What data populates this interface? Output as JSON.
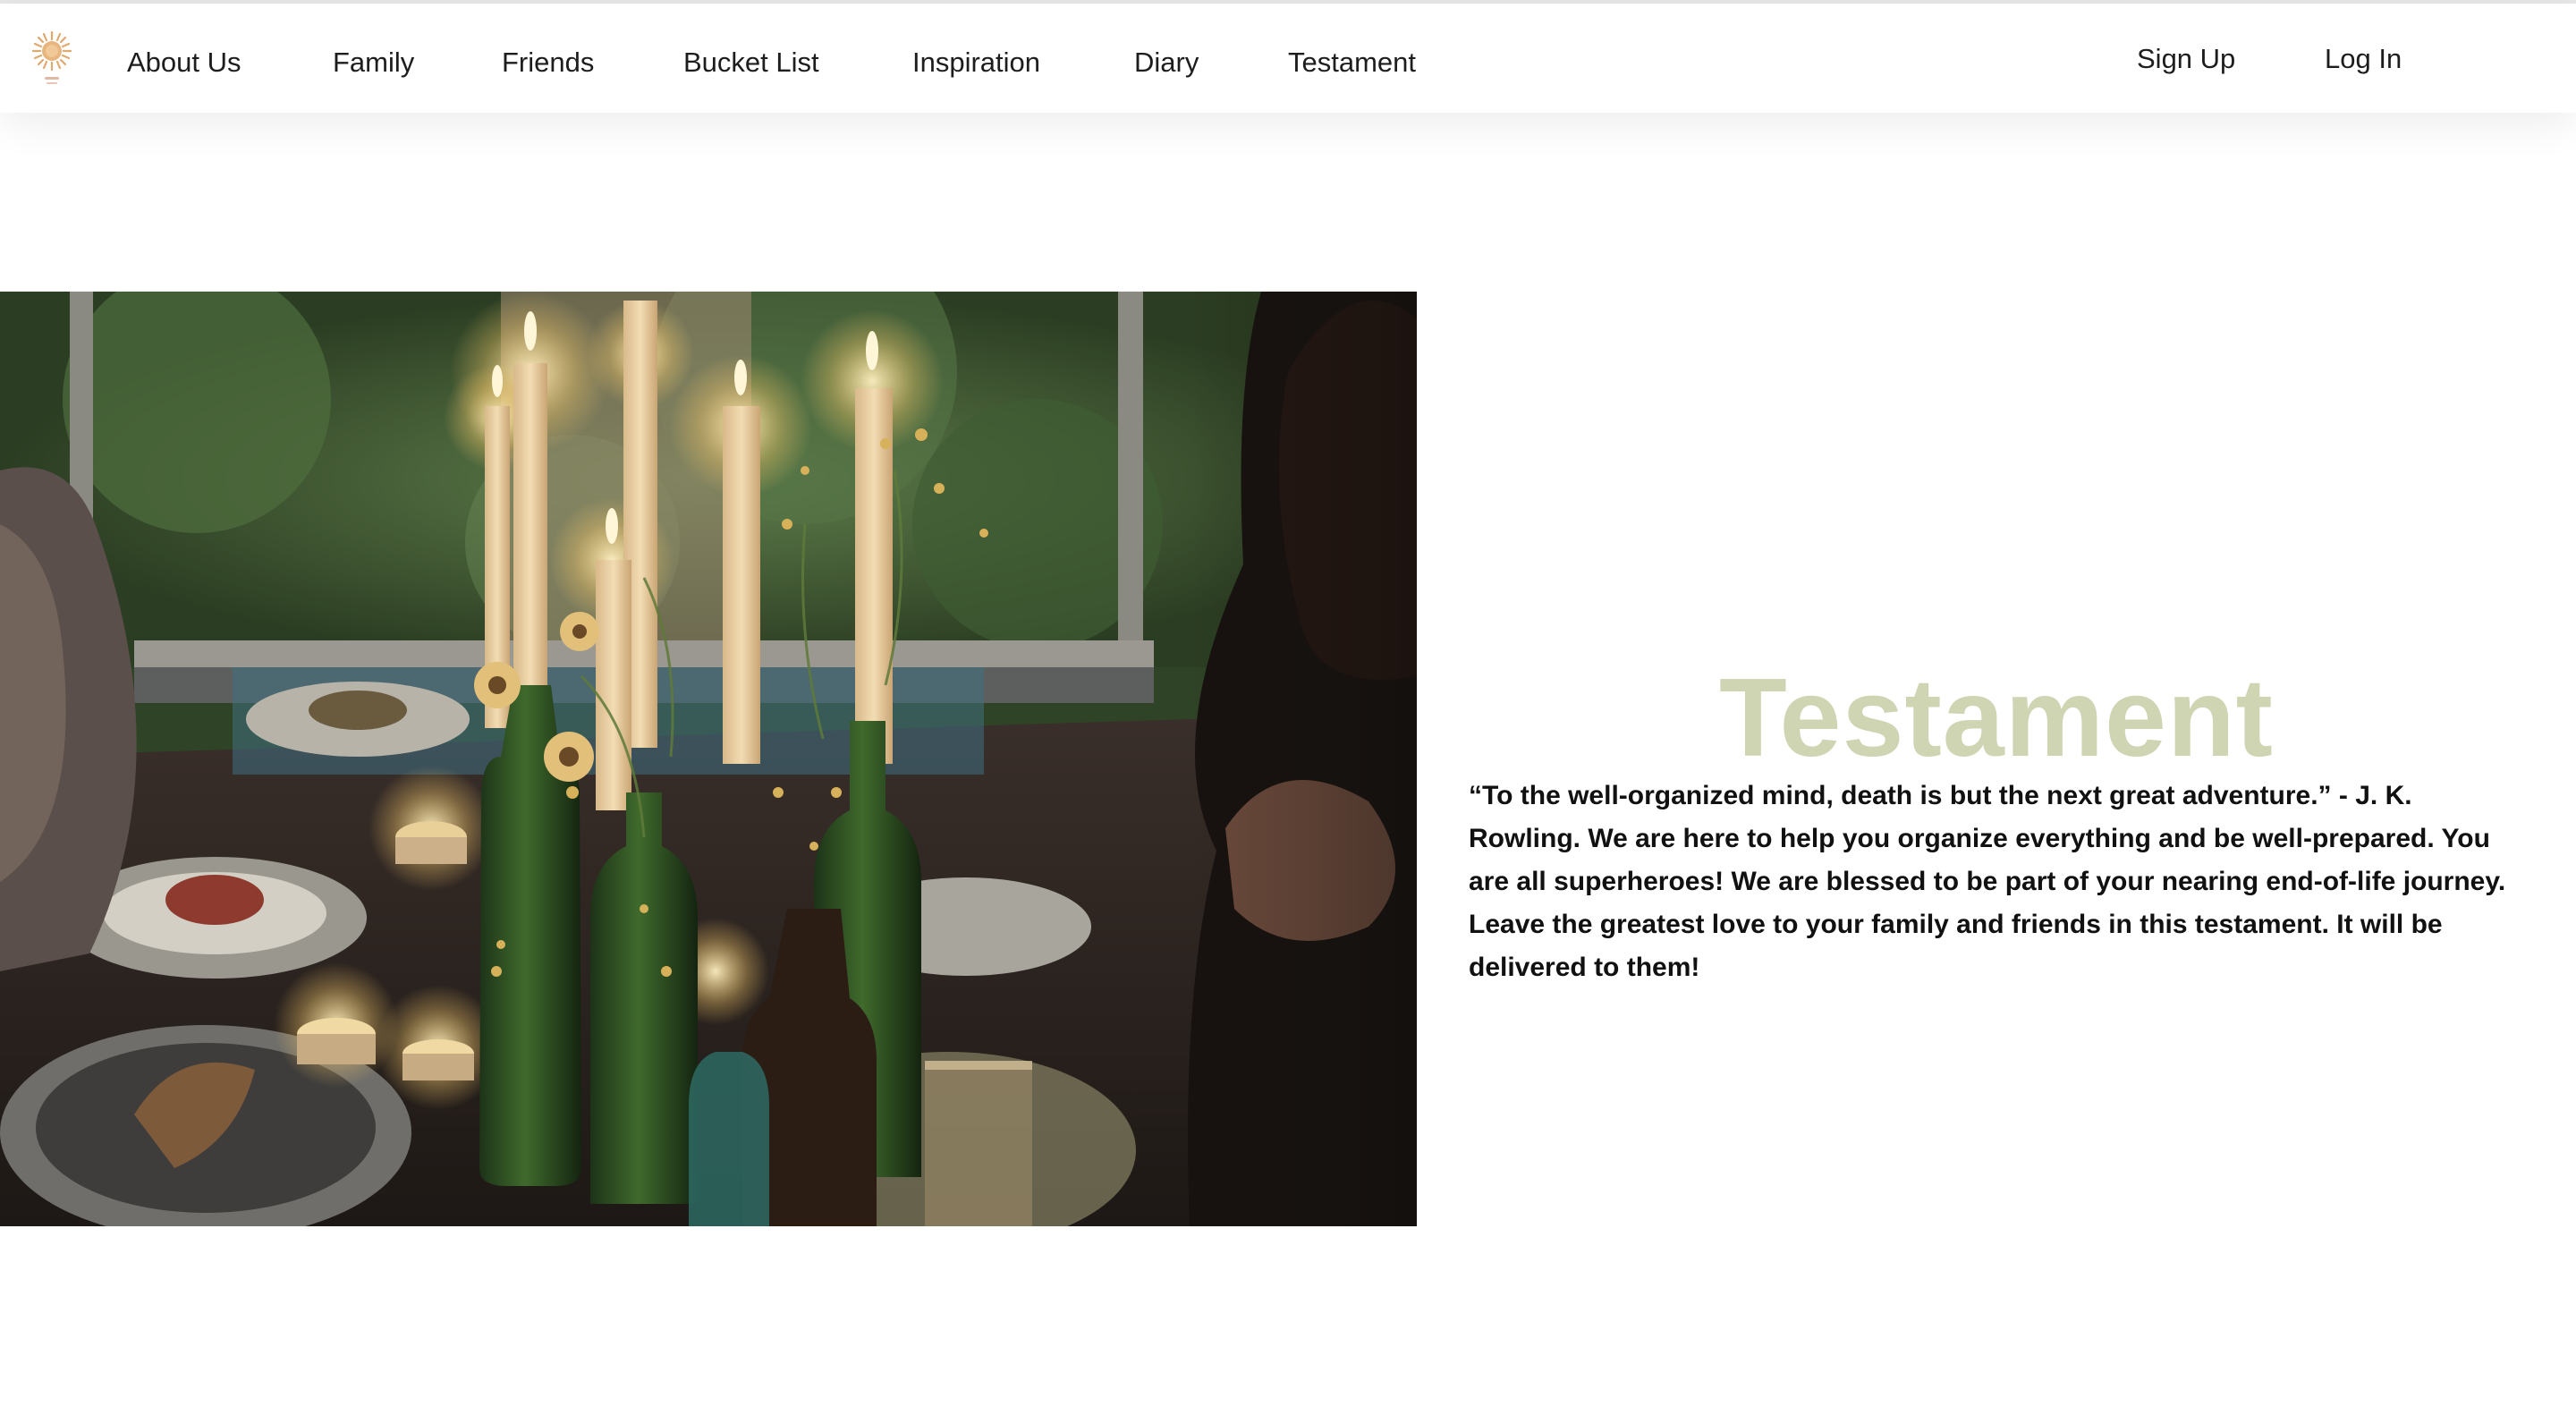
{
  "nav": {
    "logo_icon": "sun-logo-icon",
    "items": [
      {
        "label": "About Us"
      },
      {
        "label": "Family"
      },
      {
        "label": "Friends"
      },
      {
        "label": "Bucket List"
      },
      {
        "label": "Inspiration"
      },
      {
        "label": "Diary"
      },
      {
        "label": "Testament"
      }
    ],
    "sign_up_label": "Sign Up",
    "log_in_label": "Log In"
  },
  "hero": {
    "image_subject": "candlelit dinner table with bottles, flowers and a woman seated by a window"
  },
  "testament": {
    "title": "Testament",
    "body": "“To the well-organized mind, death is but the next great adventure.” - J. K. Rowling. We are here to help you organize everything and be well-prepared. You are all superheroes! We are blessed to be part of your nearing end-of-life journey. Leave the greatest love to your family and friends in this testament. It will be delivered to them!"
  },
  "colors": {
    "title_accent": "#cfd4b2",
    "logo": "#e0a96d",
    "text": "#111111"
  }
}
